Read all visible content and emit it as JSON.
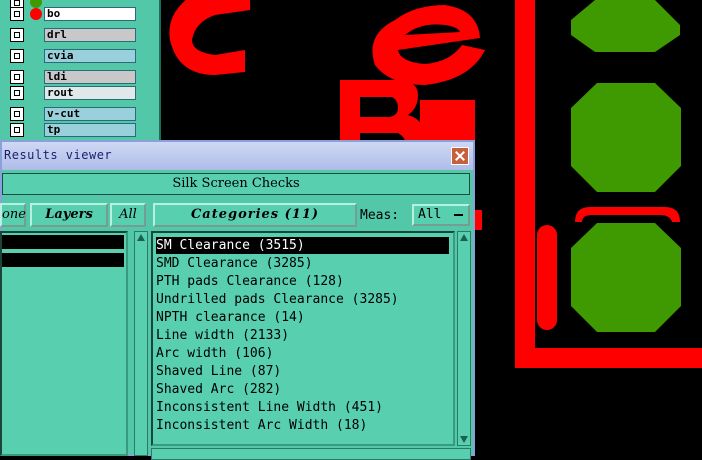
{
  "layers": [
    {
      "name": "bo",
      "dot_color": "#ff0000",
      "style": "white"
    },
    {
      "name": "drl",
      "dot_color": "",
      "style": "gray"
    },
    {
      "name": "cvia",
      "dot_color": "",
      "style": "light"
    },
    {
      "name": "ldi",
      "dot_color": "",
      "style": "gray"
    },
    {
      "name": "rout",
      "dot_color": "",
      "style": "light"
    },
    {
      "name": "v-cut",
      "dot_color": "",
      "style": "light"
    },
    {
      "name": "tp",
      "dot_color": "",
      "style": "light"
    }
  ],
  "window": {
    "title": "Results viewer",
    "checks_header": "Silk Screen Checks",
    "none_label": "one",
    "layers_label": "Layers",
    "all_label": "All",
    "categories_label": "Categories (11)",
    "meas_label": "Meas:",
    "meas_value": "All"
  },
  "categories": [
    {
      "label": "SM Clearance (3515)",
      "selected": true
    },
    {
      "label": "SMD Clearance (3285)",
      "selected": false
    },
    {
      "label": "PTH pads Clearance (128)",
      "selected": false
    },
    {
      "label": "Undrilled pads Clearance (3285)",
      "selected": false
    },
    {
      "label": "NPTH clearance (14)",
      "selected": false
    },
    {
      "label": "Line width (2133)",
      "selected": false
    },
    {
      "label": "Arc width (106)",
      "selected": false
    },
    {
      "label": "Shaved Line (87)",
      "selected": false
    },
    {
      "label": "Shaved Arc (282)",
      "selected": false
    },
    {
      "label": "Inconsistent Line Width (451)",
      "selected": false
    },
    {
      "label": "Inconsistent Arc Width (18)",
      "selected": false
    }
  ],
  "colors": {
    "board_background": "#000000",
    "silkscreen": "#ff0000",
    "pad": "#3f9900",
    "panel": "#52c8a8"
  }
}
